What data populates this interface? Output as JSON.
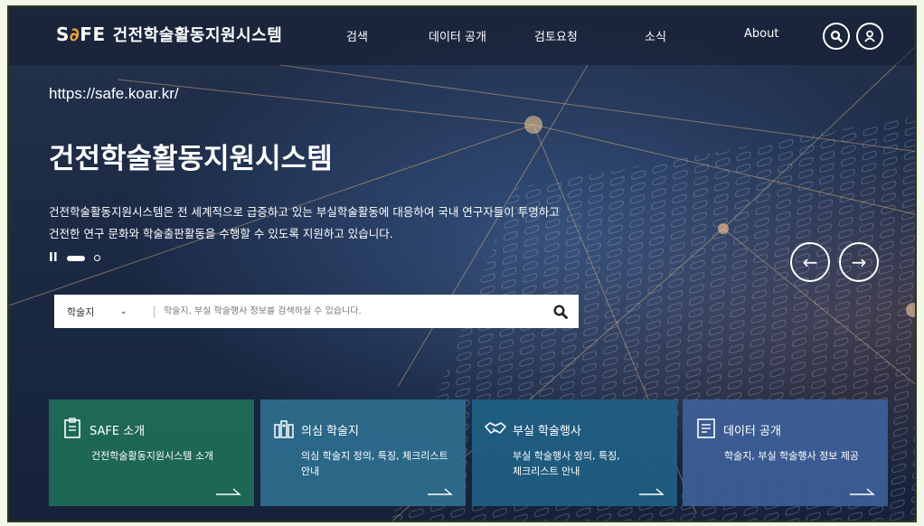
{
  "header": {
    "logo_mark": "SAFE",
    "logo_text": "건전학술활동지원시스템",
    "nav": [
      "검색",
      "데이터 공개",
      "검토요청",
      "소식",
      "About"
    ]
  },
  "hero": {
    "url": "https://safe.koar.kr/",
    "title": "건전학술활동지원시스템",
    "description": [
      "건전학술활동지원시스템은 전 세계적으로 급증하고 있는 부실학술활동에 대응하여 국내 연구자들이 투명하고",
      "건전한 연구 문화와 학술출판활동을 수행할 수 있도록 지원하고 있습니다."
    ],
    "pause": "II",
    "prev": "←",
    "next": "→"
  },
  "search": {
    "category": "학술지",
    "placeholder": "학술지, 부실 학술행사 정보를 검색하실 수 있습니다."
  },
  "cards": [
    {
      "title": "SAFE 소개",
      "desc": [
        "건전학술활동지원시스템 소개"
      ],
      "color": "#1f6e57",
      "icon": "clipboard-icon"
    },
    {
      "title": "의심 학술지",
      "desc": [
        "의심 학술지 정의, 특징, 체크리스트",
        "안내"
      ],
      "color": "#2e6e8e",
      "icon": "books-icon"
    },
    {
      "title": "부실 학술행사",
      "desc": [
        "부실 학술행사 정의, 특징,",
        "체크리스트 안내"
      ],
      "color": "#1e5f84",
      "icon": "handshake-icon"
    },
    {
      "title": "데이터 공개",
      "desc": [
        "학술지, 부실 학술행사 정보 제공"
      ],
      "color": "#3d5f99",
      "icon": "document-icon"
    }
  ]
}
